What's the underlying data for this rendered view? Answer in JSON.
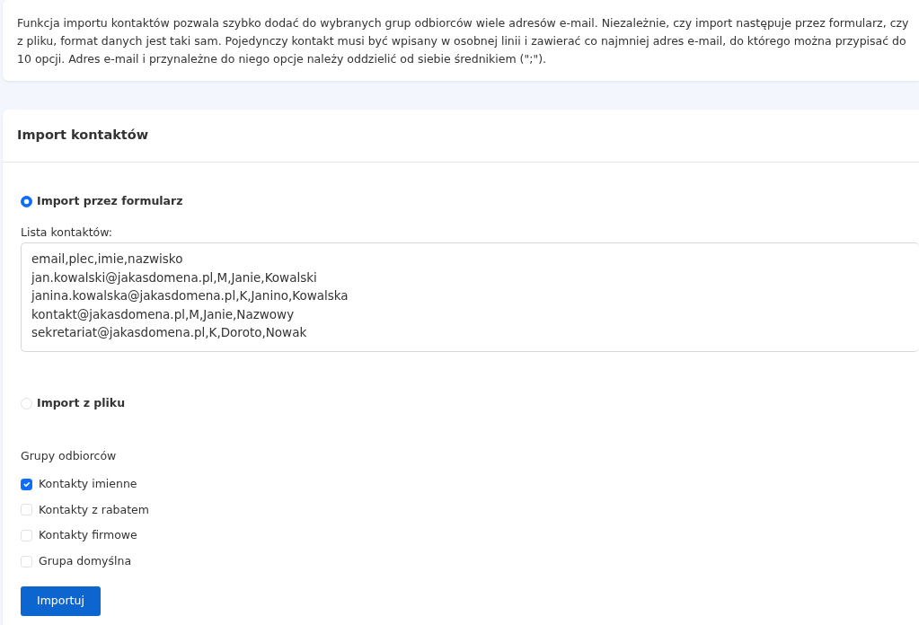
{
  "intro": {
    "text": "Funkcja importu kontaktów pozwala szybko dodać do wybranych grup odbiorców wiele adresów e-mail. Niezależnie, czy import następuje przez formularz, czy z pliku, format danych jest taki sam. Pojedynczy kontakt musi być wpisany w osobnej linii i zawierać co najmniej adres e-mail, do którego można przypisać do 10 opcji. Adres e-mail i przynależne do niego opcje należy oddzielić od siebie średnikiem (\";\")."
  },
  "card": {
    "title": "Import kontaktów"
  },
  "import_modes": [
    {
      "label": "Import przez formularz",
      "selected": true,
      "field_label": "Lista kontaktów:",
      "field_lines": [
        "email,plec,imie,nazwisko",
        "jan.kowalski@jakasdomena.pl,M,Janie,Kowalski",
        "janina.kowalska@jakasdomena.pl,K,Janino,Kowalska",
        "kontakt@jakasdomena.pl,M,Janie,Nazwowy",
        "sekretariat@jakasdomena.pl,K,Doroto,Nowak"
      ]
    },
    {
      "label": "Import z pliku",
      "selected": false
    }
  ],
  "groups": {
    "label": "Grupy odbiorców",
    "items": [
      {
        "label": "Kontakty imienne",
        "checked": true
      },
      {
        "label": "Kontakty z rabatem",
        "checked": false
      },
      {
        "label": "Kontakty firmowe",
        "checked": false
      },
      {
        "label": "Grupa domyślna",
        "checked": false
      }
    ]
  },
  "submit": "Importuj"
}
